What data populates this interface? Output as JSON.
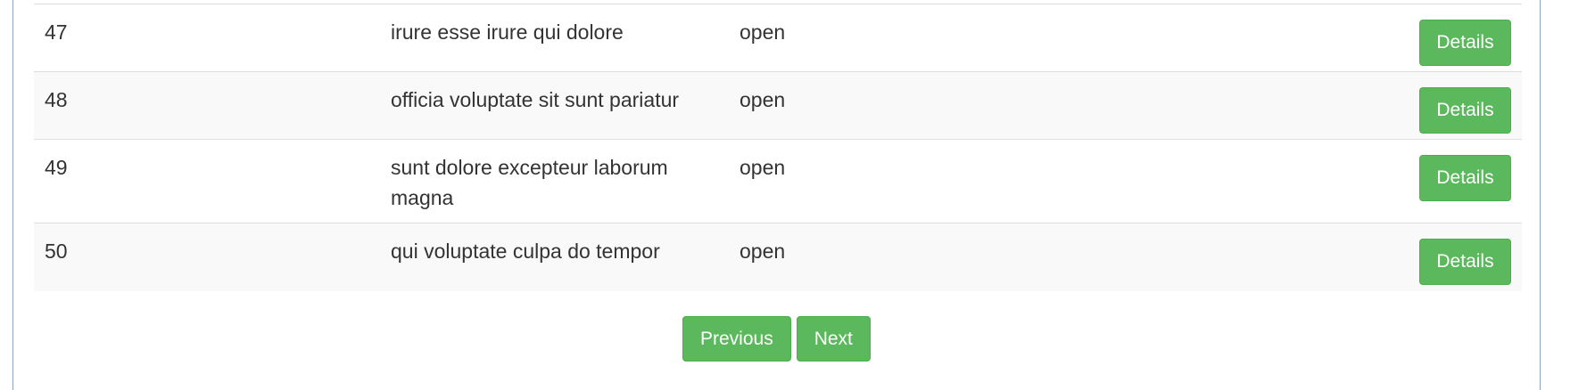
{
  "table": {
    "rows": [
      {
        "id": "47",
        "title": "irure esse irure qui dolore",
        "status": "open",
        "action": "Details"
      },
      {
        "id": "48",
        "title": "officia voluptate sit sunt pariatur",
        "status": "open",
        "action": "Details"
      },
      {
        "id": "49",
        "title": "sunt dolore excepteur laborum magna",
        "status": "open",
        "action": "Details"
      },
      {
        "id": "50",
        "title": "qui voluptate culpa do tempor",
        "status": "open",
        "action": "Details"
      }
    ]
  },
  "pagination": {
    "previous_label": "Previous",
    "next_label": "Next"
  },
  "colors": {
    "button_green": "#5cb85c",
    "row_stripe": "#f9f9f9",
    "border": "#dddddd"
  }
}
